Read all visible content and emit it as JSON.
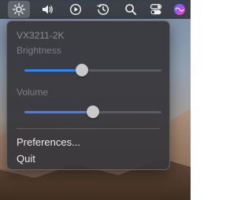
{
  "menubar": {
    "icons": [
      "display-brightness-icon",
      "speaker-icon",
      "play-icon",
      "time-machine-icon",
      "search-icon",
      "control-center-icon",
      "siri-icon"
    ]
  },
  "panel": {
    "device_name": "VX3211-2K",
    "brightness": {
      "label": "Brightness",
      "level": 0.42
    },
    "volume": {
      "label": "Volume",
      "level": 0.5
    },
    "menu_items": [
      {
        "label": "Preferences..."
      },
      {
        "label": "Quit"
      }
    ]
  },
  "colors": {
    "accent": "#3b82f6",
    "panel_bg": "#36363a",
    "knob": "#c9c9cb",
    "text": "#ececec",
    "secondary_text": "#8d8d91"
  }
}
